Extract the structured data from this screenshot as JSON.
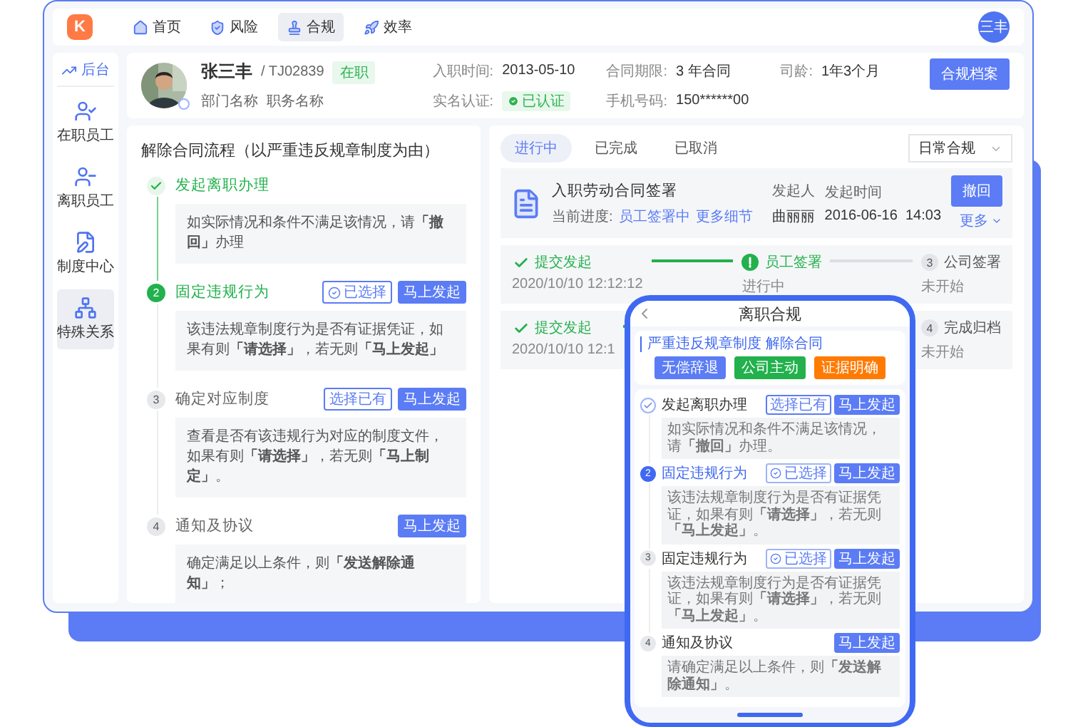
{
  "nav": {
    "logo": "K",
    "items": [
      {
        "label": "首页",
        "selected": false
      },
      {
        "label": "风险",
        "selected": false
      },
      {
        "label": "合规",
        "selected": true
      },
      {
        "label": "效率",
        "selected": false
      }
    ],
    "avatar": "三丰"
  },
  "sidebar": {
    "header": "后台",
    "items": [
      {
        "label": "在职员工",
        "selected": false
      },
      {
        "label": "离职员工",
        "selected": false
      },
      {
        "label": "制度中心",
        "selected": false
      },
      {
        "label": "特殊关系",
        "selected": true
      }
    ]
  },
  "profile": {
    "name": "张三丰",
    "id": "/ TJ02839",
    "status": "在职",
    "dept": "部门名称",
    "position": "职务名称",
    "fields": [
      {
        "label": "入职时间:",
        "value": "2013-05-10",
        "kind": "text"
      },
      {
        "label": "合同期限:",
        "value": "3 年合同",
        "kind": "text"
      },
      {
        "label": "司龄:",
        "value": "1年3个月",
        "kind": "text"
      },
      {
        "label": "实名认证:",
        "value": "已认证",
        "kind": "badge"
      },
      {
        "label": "手机号码:",
        "value": "150******00",
        "kind": "text"
      }
    ],
    "button": "合规档案"
  },
  "flow": {
    "title": "解除合同流程（以严重违反规章制度为由）",
    "steps": [
      {
        "kind": "done",
        "title": "发起离职办理",
        "description": "如实际情况和条件不满足该情况，请**「撤回」**办理"
      },
      {
        "kind": "active",
        "number": "2",
        "title": "固定违规行为",
        "buttons": [
          {
            "label": "已选择",
            "kind": "checked"
          },
          {
            "label": "马上发起",
            "kind": "primary"
          }
        ],
        "description": "该违法规章制度行为是否有证据凭证，如果有则**「请选择」**，若无则**「马上发起」**"
      },
      {
        "kind": "todo",
        "number": "3",
        "title": "确定对应制度",
        "buttons": [
          {
            "label": "选择已有",
            "kind": "outline"
          },
          {
            "label": "马上发起",
            "kind": "primary"
          }
        ],
        "description": "查看是否有该违规行为对应的制度文件，如果有则**「请选择」**，若无则**「马上制定」**。"
      },
      {
        "kind": "todo",
        "number": "4",
        "title": "通知及协议",
        "buttons": [
          {
            "label": "马上发起",
            "kind": "primary"
          }
        ],
        "description": "确定满足以上条件，则**「发送解除通知」**；"
      }
    ]
  },
  "tasks": {
    "tabs": [
      {
        "label": "进行中",
        "selected": true
      },
      {
        "label": "已完成",
        "selected": false
      },
      {
        "label": "已取消",
        "selected": false
      }
    ],
    "filter": "日常合规",
    "contract": {
      "title": "入职劳动合同签署",
      "progress_label": "当前进度:",
      "progress_value": "员工签署中",
      "details_link": "更多细节",
      "initiator_label": "发起人",
      "initiator": "曲丽丽",
      "time_label": "发起时间",
      "time": "2016-06-16  14:03",
      "button": "撤回",
      "more": "更多"
    },
    "progress_rows": [
      {
        "steps": [
          {
            "kind": "done",
            "label": "提交发起",
            "detail": "2020/10/10 12:12:12"
          },
          {
            "kind": "active",
            "label": "员工签署",
            "detail": "进行中"
          },
          {
            "kind": "todo",
            "number": "3",
            "label": "公司签署",
            "detail": "未开始"
          }
        ]
      },
      {
        "steps": [
          {
            "kind": "done",
            "label": "提交发起",
            "detail": "2020/10/10 12:1"
          },
          {
            "kind": "todo",
            "number": "4",
            "label": "完成归档",
            "detail": "未开始"
          }
        ]
      }
    ]
  },
  "phone": {
    "title": "离职合规",
    "heading": "严重违反规章制度 解除合同",
    "tags": [
      {
        "label": "无偿辞退",
        "color": "#5b7cf5"
      },
      {
        "label": "公司主动",
        "color": "#22b14c"
      },
      {
        "label": "证据明确",
        "color": "#ff7a00"
      }
    ],
    "steps": [
      {
        "kind": "done",
        "title": "发起离职办理",
        "buttons": [
          {
            "label": "选择已有",
            "kind": "outline"
          },
          {
            "label": "马上发起",
            "kind": "primary"
          }
        ],
        "description": "如实际情况和条件不满足该情况，请**「撤回」**办理。"
      },
      {
        "kind": "active",
        "number": "2",
        "title": "固定违规行为",
        "buttons": [
          {
            "label": "已选择",
            "kind": "checked"
          },
          {
            "label": "马上发起",
            "kind": "primary"
          }
        ],
        "description": "该违法规章制度行为是否有证据凭证，如果有则**「请选择」**，若无则**「马上发起」**。"
      },
      {
        "kind": "todo",
        "number": "3",
        "title": "固定违规行为",
        "buttons": [
          {
            "label": "已选择",
            "kind": "checked"
          },
          {
            "label": "马上发起",
            "kind": "primary"
          }
        ],
        "description": "该违法规章制度行为是否有证据凭证，如果有则**「请选择」**，若无则**「马上发起」**。"
      },
      {
        "kind": "todo",
        "number": "4",
        "title": "通知及协议",
        "buttons": [
          {
            "label": "马上发起",
            "kind": "primary"
          }
        ],
        "description": "请确定满足以上条件，则**「发送解除通知」**。"
      }
    ]
  }
}
